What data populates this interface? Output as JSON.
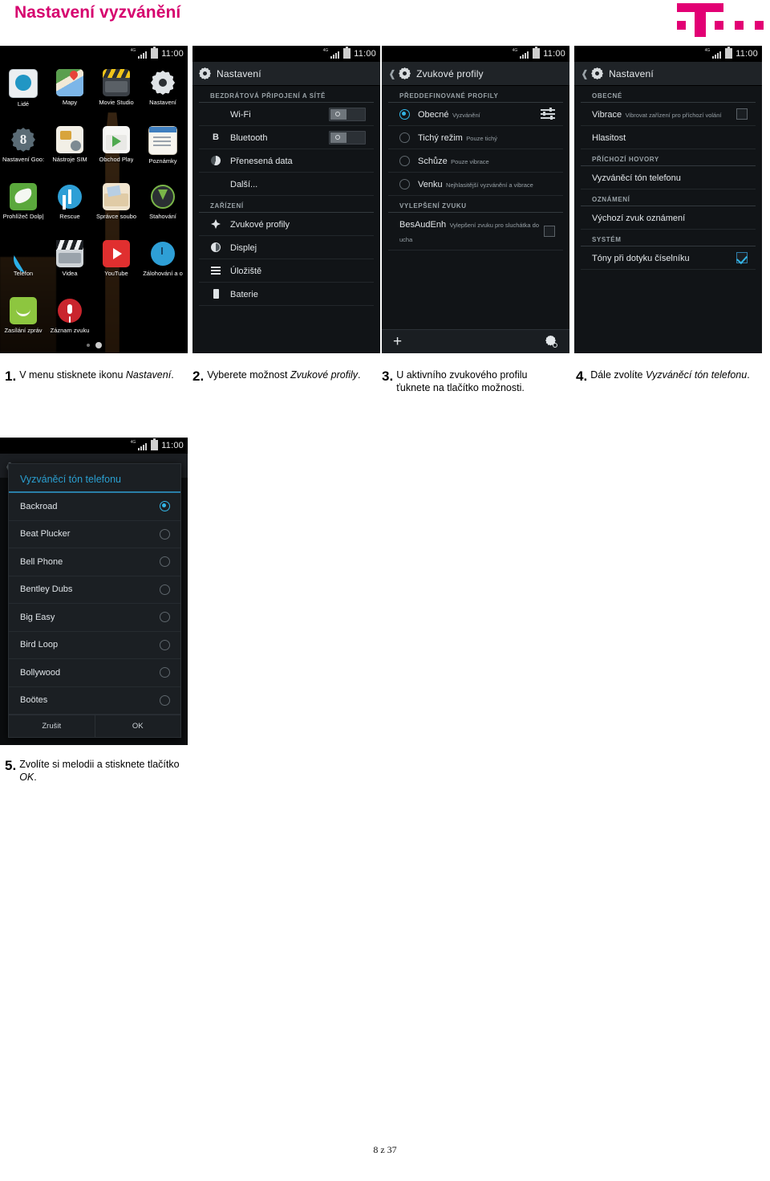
{
  "header": {
    "title": "Nastavení vyzvánění",
    "brand": "T-Mobile",
    "accent_color": "#e20074"
  },
  "status_bar": {
    "time": "11:00",
    "network": "4G"
  },
  "screens": {
    "home": {
      "apps": [
        {
          "label": "Lidé",
          "icon": "people-icon"
        },
        {
          "label": "Mapy",
          "icon": "maps-icon"
        },
        {
          "label": "Movie Studio",
          "icon": "movie-studio-icon"
        },
        {
          "label": "Nastavení",
          "icon": "settings-gear-icon"
        },
        {
          "label": "Nastavení Goo:",
          "icon": "google-settings-icon"
        },
        {
          "label": "Nástroje SIM",
          "icon": "sim-tools-icon"
        },
        {
          "label": "Obchod Play",
          "icon": "play-store-icon"
        },
        {
          "label": "Poznámky",
          "icon": "notes-icon"
        },
        {
          "label": "Prohlížeč Dolp|",
          "icon": "dolphin-browser-icon"
        },
        {
          "label": "Rescue",
          "icon": "rescue-icon"
        },
        {
          "label": "Správce soubo",
          "icon": "file-manager-icon"
        },
        {
          "label": "Stahování",
          "icon": "downloads-icon"
        },
        {
          "label": "Telefon",
          "icon": "phone-icon"
        },
        {
          "label": "Videa",
          "icon": "videos-icon"
        },
        {
          "label": "YouTube",
          "icon": "youtube-icon"
        },
        {
          "label": "Zálohování a o",
          "icon": "backup-icon"
        },
        {
          "label": "Zasílání zpráv",
          "icon": "messaging-icon"
        },
        {
          "label": "Záznam zvuku",
          "icon": "sound-recorder-icon"
        }
      ],
      "page_dots": {
        "count": 2,
        "active_index": 1
      }
    },
    "settings": {
      "title": "Nastavení",
      "sections": [
        {
          "label": "BEZDRÁTOVÁ PŘIPOJENÍ A SÍTĚ",
          "rows": [
            {
              "title": "Wi-Fi",
              "icon": "wifi-icon",
              "control": "toggle",
              "value": "off"
            },
            {
              "title": "Bluetooth",
              "icon": "bluetooth-icon",
              "control": "toggle",
              "value": "off"
            },
            {
              "title": "Přenesená data",
              "icon": "data-usage-icon",
              "control": "none"
            },
            {
              "title": "Další...",
              "icon": "none",
              "control": "none"
            }
          ]
        },
        {
          "label": "ZAŘÍZENÍ",
          "rows": [
            {
              "title": "Zvukové profily",
              "icon": "sound-profiles-icon",
              "control": "none"
            },
            {
              "title": "Displej",
              "icon": "display-icon",
              "control": "none"
            },
            {
              "title": "Úložiště",
              "icon": "storage-icon",
              "control": "none"
            },
            {
              "title": "Baterie",
              "icon": "battery-icon",
              "control": "none"
            }
          ]
        }
      ]
    },
    "sound_profiles": {
      "title": "Zvukové profily",
      "sections": [
        {
          "label": "PŘEDDEFINOVANÉ PROFILY",
          "rows": [
            {
              "title": "Obecné",
              "subtitle": "Vyzvánění",
              "selected": true,
              "trailing": "equalizer-icon"
            },
            {
              "title": "Tichý režim",
              "subtitle": "Pouze tichý",
              "selected": false,
              "trailing": "none"
            },
            {
              "title": "Schůze",
              "subtitle": "Pouze vibrace",
              "selected": false,
              "trailing": "none"
            },
            {
              "title": "Venku",
              "subtitle": "Nejhlasitější vyzvánění a vibrace",
              "selected": false,
              "trailing": "none"
            }
          ]
        },
        {
          "label": "VYLEPŠENÍ ZVUKU",
          "rows": [
            {
              "title": "BesAudEnh",
              "subtitle": "Vylepšení zvuku pro sluchátka do ucha",
              "checkbox": false
            }
          ]
        }
      ],
      "bottom_bar": {
        "add": "+",
        "settings_icon": "profile-settings-icon"
      }
    },
    "profile_settings": {
      "title": "Nastavení",
      "sections": [
        {
          "label": "OBECNÉ",
          "rows": [
            {
              "title": "Vibrace",
              "subtitle": "Vibrovat zařízení pro příchozí volání",
              "checkbox": false
            },
            {
              "title": "Hlasitost",
              "subtitle": "",
              "checkbox": null
            }
          ]
        },
        {
          "label": "PŘÍCHOZÍ HOVORY",
          "rows": [
            {
              "title": "Vyzváněcí tón telefonu",
              "subtitle": "",
              "checkbox": null
            }
          ]
        },
        {
          "label": "OZNÁMENÍ",
          "rows": [
            {
              "title": "Výchozí zvuk oznámení",
              "subtitle": "",
              "checkbox": null
            }
          ]
        },
        {
          "label": "SYSTÉM",
          "rows": [
            {
              "title": "Tóny při dotyku číselníku",
              "subtitle": "",
              "checkbox": true
            }
          ]
        }
      ]
    },
    "ringtone_dialog": {
      "title": "Vyzváněcí tón telefonu",
      "accent_color": "#2a9fd0",
      "options": [
        {
          "name": "Backroad",
          "selected": true
        },
        {
          "name": "Beat Plucker",
          "selected": false
        },
        {
          "name": "Bell Phone",
          "selected": false
        },
        {
          "name": "Bentley Dubs",
          "selected": false
        },
        {
          "name": "Big Easy",
          "selected": false
        },
        {
          "name": "Bird Loop",
          "selected": false
        },
        {
          "name": "Bollywood",
          "selected": false
        },
        {
          "name": "Boötes",
          "selected": false
        }
      ],
      "buttons": {
        "cancel": "Zrušit",
        "ok": "OK"
      }
    }
  },
  "steps": [
    {
      "num": "1.",
      "pre": "V menu stisknete ikonu ",
      "em": "Nastavení",
      "post": "."
    },
    {
      "num": "2.",
      "pre": "Vyberete možnost ",
      "em": "Zvukové profily",
      "post": "."
    },
    {
      "num": "3.",
      "pre": "U aktivního zvukového profilu ťuknete na tlačítko možnosti.",
      "em": "",
      "post": ""
    },
    {
      "num": "4.",
      "pre": "Dále zvolíte ",
      "em": "Vyzváněcí tón telefonu",
      "post": "."
    },
    {
      "num": "5.",
      "pre": "Zvolíte si melodii a stisknete tlačítko ",
      "em": "OK",
      "post": "."
    }
  ],
  "footer": {
    "page": "8 z 37"
  }
}
